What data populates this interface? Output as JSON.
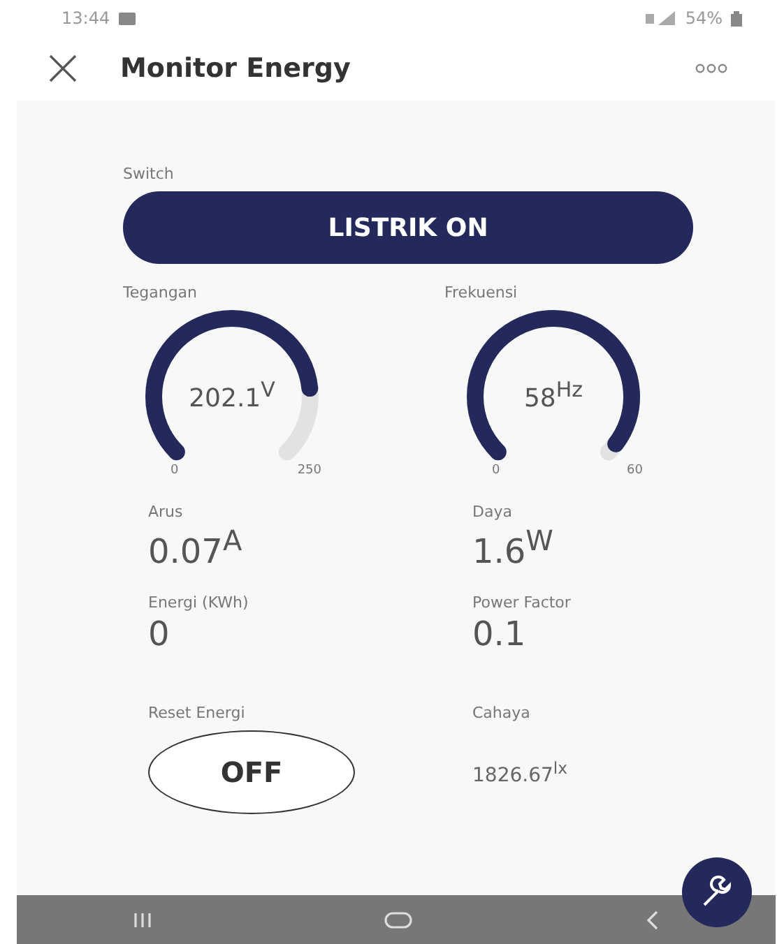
{
  "status_bar": {
    "time": "13:44",
    "battery": "54%"
  },
  "header": {
    "title": "Monitor Energy"
  },
  "switch": {
    "label": "Switch",
    "button": "LISTRIK ON"
  },
  "gauges": [
    {
      "label": "Tegangan",
      "value": "202.1$^{V}$",
      "min": "0",
      "max": "250",
      "level": 0.81
    },
    {
      "label": "Frekuensi",
      "value": "58$^{Hz}$",
      "min": "0",
      "max": "60",
      "level": 0.97
    }
  ],
  "readings": [
    {
      "kind": "value",
      "label": "Arus",
      "value": "0.07$^{A}$"
    },
    {
      "kind": "value",
      "label": "Daya",
      "value": "1.6$^{W}$"
    },
    {
      "kind": "value",
      "label": "Energi (KWh)",
      "value": "0"
    },
    {
      "kind": "value",
      "label": "Power Factor",
      "value": "0.1"
    },
    {
      "kind": "button",
      "label": "Reset Energi",
      "value": "OFF"
    },
    {
      "kind": "small",
      "label": "Cahaya",
      "value": "1826.67$^{lx}$"
    }
  ]
}
